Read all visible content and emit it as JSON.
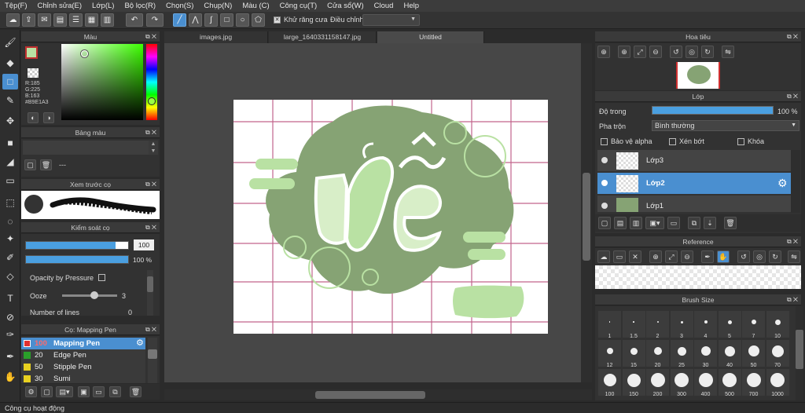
{
  "menu": [
    "Tệp(F)",
    "Chỉnh sửa(E)",
    "Lớp(L)",
    "Bộ lọc(R)",
    "Chọn(S)",
    "Chụp(N)",
    "Màu (C)",
    "Công cụ(T)",
    "Cửa sổ(W)",
    "Cloud",
    "Help"
  ],
  "toolbar": {
    "antialias": "Khử răng cưa",
    "correction": "Điều chỉnh"
  },
  "color_panel": {
    "title": "Màu",
    "r": "R:185",
    "g": "G:225",
    "b": "B:163",
    "hex": "#B9E1A3",
    "fg": "#b9e1a3"
  },
  "palette": {
    "title": "Bảng màu",
    "value": "---"
  },
  "brush_preview": {
    "title": "Xem trước cọ"
  },
  "brush_control": {
    "title": "Kiểm soát cọ",
    "size": "100",
    "opacity": "100 %",
    "opacity_by_pressure": "Opacity by Pressure",
    "ooze_label": "Ooze",
    "ooze_value": "3",
    "lines_label": "Number of lines",
    "lines_value": "0"
  },
  "brush_list": {
    "title": "Cọ: Mapping Pen",
    "items": [
      {
        "size": "100",
        "name": "Mapping Pen",
        "color": "#e03030"
      },
      {
        "size": "20",
        "name": "Edge Pen",
        "color": "#2aa02a"
      },
      {
        "size": "50",
        "name": "Stipple Pen",
        "color": "#e8d020"
      },
      {
        "size": "30",
        "name": "Sumi",
        "color": "#e8d020"
      }
    ]
  },
  "tabs": [
    "images.jpg",
    "large_1640331158147.jpg",
    "Untitled"
  ],
  "navigator": {
    "title": "Hoa tiêu"
  },
  "layers": {
    "title": "Lớp",
    "opacity_label": "Độ trong",
    "opacity_value": "100 %",
    "blend_label": "Pha trộn",
    "blend_value": "Bình thường",
    "protect_alpha": "Bảo vệ alpha",
    "clip": "Xén bớt",
    "lock": "Khóa",
    "items": [
      "Lớp3",
      "Lớp2",
      "Lớp1"
    ]
  },
  "reference": {
    "title": "Reference"
  },
  "brush_size": {
    "title": "Brush Size",
    "sizes": [
      "1",
      "1.5",
      "2",
      "3",
      "4",
      "5",
      "7",
      "10",
      "12",
      "15",
      "20",
      "25",
      "30",
      "40",
      "50",
      "70",
      "100",
      "150",
      "200",
      "300",
      "400",
      "500",
      "700",
      "1000"
    ]
  },
  "status": "Công cụ hoạt động"
}
